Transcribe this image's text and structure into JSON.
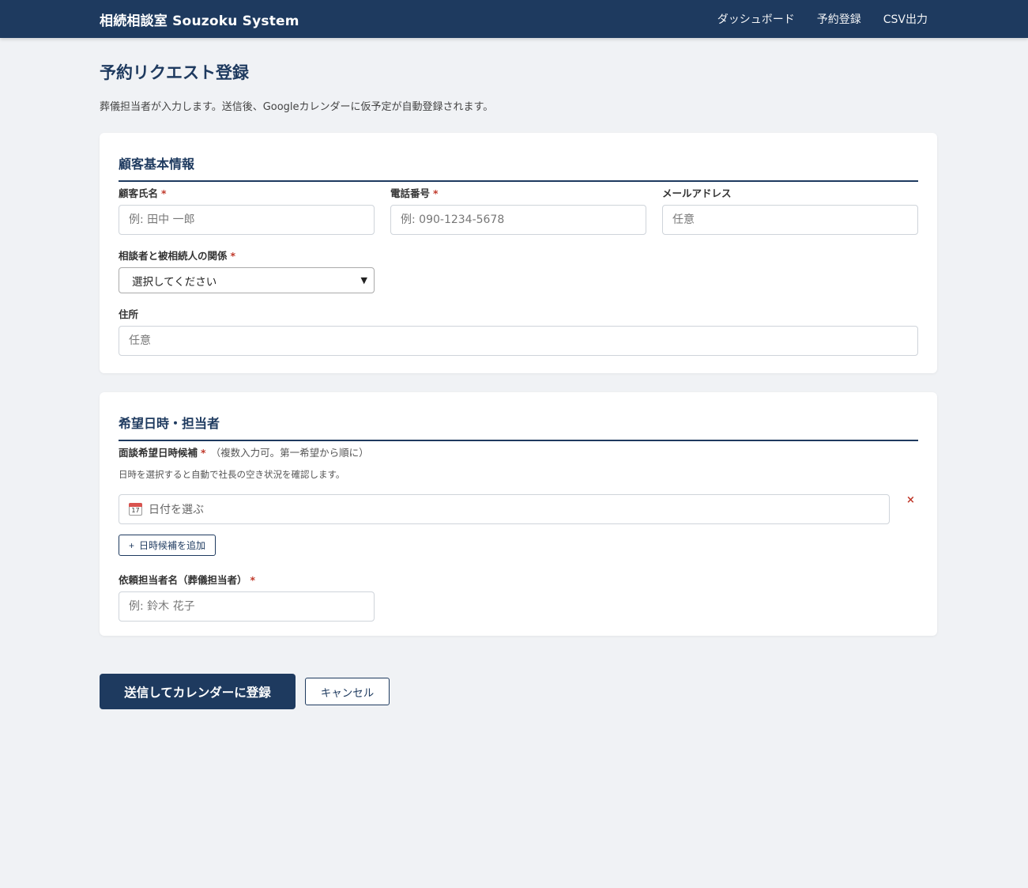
{
  "header": {
    "brand": "相続相談室 Souzoku System",
    "nav": [
      "ダッシュボード",
      "予約登録",
      "CSV出力"
    ]
  },
  "page": {
    "title": "予約リクエスト登録",
    "description": "葬儀担当者が入力します。送信後、Googleカレンダーに仮予定が自動登録されます。"
  },
  "required_mark": "*",
  "section1": {
    "title": "顧客基本情報",
    "customer_name": {
      "label": "顧客氏名",
      "placeholder": "例: 田中 一郎"
    },
    "phone": {
      "label": "電話番号",
      "placeholder": "例: 090-1234-5678"
    },
    "email": {
      "label": "メールアドレス",
      "placeholder": "任意"
    },
    "relationship": {
      "label": "相談者と被相続人の関係",
      "selected": "選択してください"
    },
    "address": {
      "label": "住所",
      "placeholder": "任意"
    }
  },
  "section2": {
    "title": "希望日時・担当者",
    "datetime": {
      "label": "面談希望日時候補",
      "note": "（複数入力可。第一希望から順に）",
      "help": "日時を選択すると自動で社長の空き状況を確認します。",
      "placeholder": "日付を選ぶ",
      "calendar_day": "17",
      "remove": "×",
      "add_label": "日時候補を追加",
      "add_icon": "+"
    },
    "staff": {
      "label": "依頼担当者名（葬儀担当者）",
      "placeholder": "例: 鈴木 花子"
    }
  },
  "actions": {
    "submit": "送信してカレンダーに登録",
    "cancel": "キャンセル"
  }
}
